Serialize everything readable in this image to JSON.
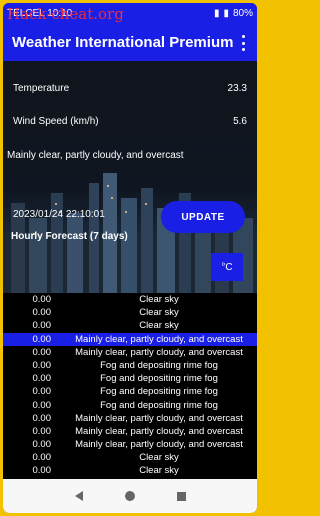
{
  "status": {
    "carrier_time": "TELCEL 10:10",
    "watermark": "Hack-cheat.org",
    "battery": "80%"
  },
  "app": {
    "title": "Weather International Premium",
    "menu_icon": "more-vert-icon"
  },
  "current": {
    "temperature_label": "Temperature",
    "temperature_value": "23.3",
    "wind_label": "Wind Speed (km/h)",
    "wind_value": "5.6",
    "condition": "Mainly clear, partly cloudy, and overcast",
    "timestamp": "2023/01/24 22:10:01",
    "update_label": "UPDATE"
  },
  "hourly": {
    "heading": "Hourly Forecast (7 days)",
    "unit_label": "°C",
    "rows": [
      {
        "value": "0.00",
        "desc": "Clear sky"
      },
      {
        "value": "0.00",
        "desc": "Clear sky"
      },
      {
        "value": "0.00",
        "desc": "Clear sky"
      },
      {
        "value": "0.00",
        "desc": "Mainly clear, partly cloudy, and overcast"
      },
      {
        "value": "0.00",
        "desc": "Mainly clear, partly cloudy, and overcast"
      },
      {
        "value": "0.00",
        "desc": "Fog and depositing rime fog"
      },
      {
        "value": "0.00",
        "desc": "Fog and depositing rime fog"
      },
      {
        "value": "0.00",
        "desc": "Fog and depositing rime fog"
      },
      {
        "value": "0.00",
        "desc": "Fog and depositing rime fog"
      },
      {
        "value": "0.00",
        "desc": "Mainly clear, partly cloudy, and overcast"
      },
      {
        "value": "0.00",
        "desc": "Mainly clear, partly cloudy, and overcast"
      },
      {
        "value": "0.00",
        "desc": "Mainly clear, partly cloudy, and overcast"
      },
      {
        "value": "0.00",
        "desc": "Clear sky"
      },
      {
        "value": "0.00",
        "desc": "Clear sky"
      }
    ]
  },
  "colors": {
    "accent": "#1a1fe6",
    "frame": "#f2c200"
  }
}
